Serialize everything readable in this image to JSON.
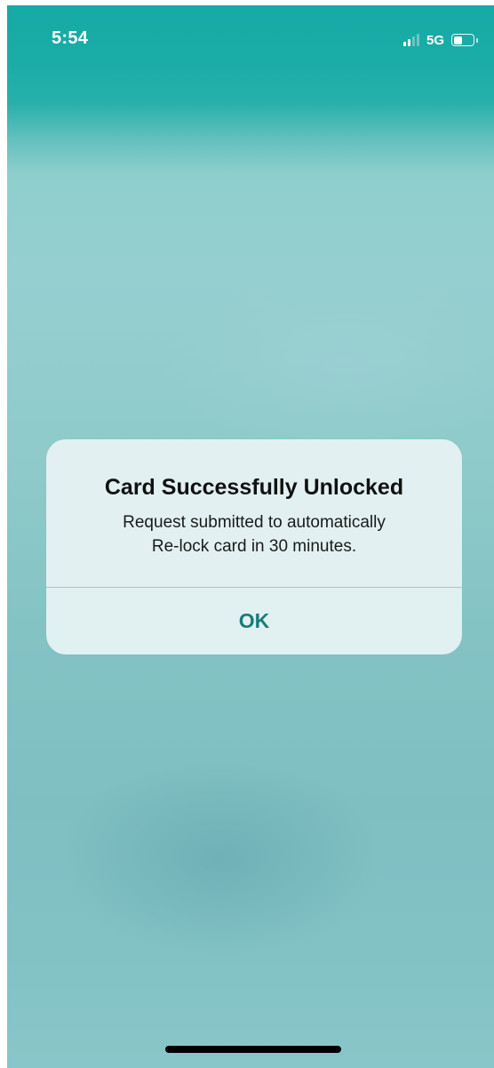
{
  "status_bar": {
    "time": "5:54",
    "network": "5G",
    "signal_bars_active": 2,
    "signal_bars_total": 4,
    "battery_level": 0.45
  },
  "alert": {
    "title": "Card Successfully Unlocked",
    "message_lines": [
      "Request submitted to automatically",
      "Re-lock card in 30 minutes."
    ],
    "ok_label": "OK"
  },
  "colors": {
    "accent": "#177e77",
    "header_teal": "#17aaa6",
    "background_teal": "#8fcaca"
  }
}
